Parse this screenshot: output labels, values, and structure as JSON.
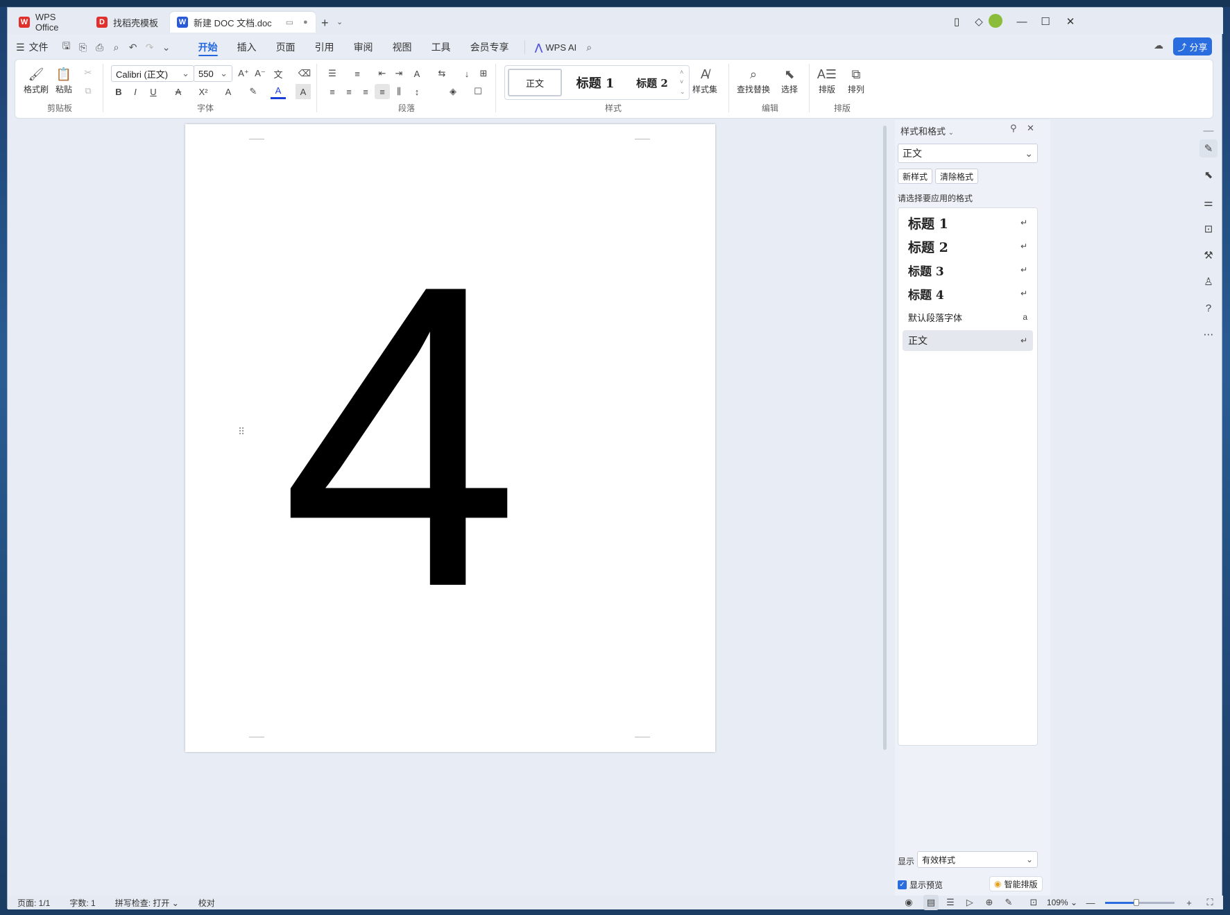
{
  "tabs": [
    {
      "label": "WPS Office",
      "icon": "wps-logo-icon",
      "color": "#e0302b"
    },
    {
      "label": "找稻壳模板",
      "icon": "docer-icon",
      "color": "#e0302b"
    },
    {
      "label": "新建 DOC 文档.doc",
      "icon": "word-doc-icon",
      "color": "#2a5bd7",
      "active": true
    }
  ],
  "menu": {
    "file_label": "文件",
    "items": [
      "开始",
      "插入",
      "页面",
      "引用",
      "审阅",
      "视图",
      "工具",
      "会员专享"
    ],
    "active": "开始",
    "wps_ai": "WPS AI",
    "share": "分享"
  },
  "ribbon": {
    "clipboard": {
      "format_painter": "格式刷",
      "paste": "粘贴",
      "group": "剪贴板"
    },
    "font": {
      "name": "Calibri (正文)",
      "size": "550",
      "group": "字体"
    },
    "paragraph": {
      "group": "段落"
    },
    "styles": {
      "normal": "正文",
      "h1": "标题 1",
      "h2": "标题 2",
      "style_set": "样式集",
      "group": "样式"
    },
    "edit": {
      "find_replace": "查找替换",
      "select": "选择",
      "group": "编辑"
    },
    "layout": {
      "arrange": "排版",
      "order": "排列",
      "group": "排版"
    }
  },
  "document": {
    "content": "4"
  },
  "styles_panel": {
    "title": "样式和格式",
    "current": "正文",
    "new_style": "新样式",
    "clear_format": "清除格式",
    "prompt": "请选择要应用的格式",
    "items": [
      "标题 1",
      "标题 2",
      "标题 3",
      "标题 4",
      "默认段落字体",
      "正文"
    ],
    "selected": "正文",
    "show_label": "显示",
    "show_value": "有效样式",
    "preview_label": "显示预览",
    "preview_checked": true,
    "smart_layout": "智能排版"
  },
  "statusbar": {
    "page": "页面: 1/1",
    "words": "字数: 1",
    "spell": "拼写检查: 打开",
    "proof": "校对",
    "zoom": "109%",
    "zoom_level": 0.45
  },
  "colors": {
    "accent": "#2a6ddf",
    "wps_red": "#e0302b"
  }
}
